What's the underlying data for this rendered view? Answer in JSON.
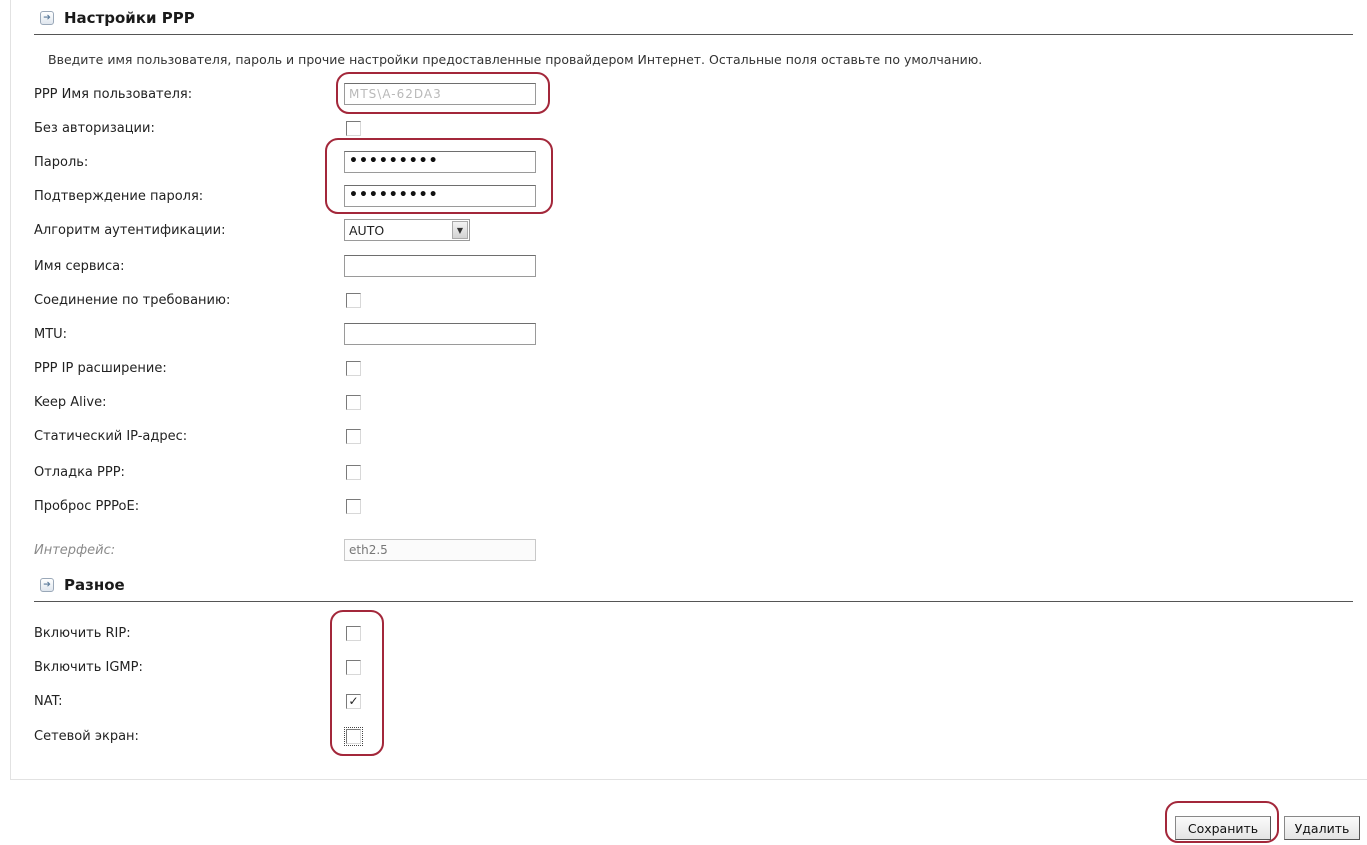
{
  "ppp_section": {
    "title": "Настройки PPP",
    "intro": "Введите имя пользователя, пароль и прочие настройки предоставленные провайдером Интернет. Остальные поля оставьте по умолчанию.",
    "username": {
      "label": "PPP Имя пользователя:",
      "value": "MTS\\A-62DA3"
    },
    "no_auth": {
      "label": "Без авторизации:",
      "checked": false
    },
    "password": {
      "label": "Пароль:",
      "value": "•••••••••"
    },
    "password_confirm": {
      "label": "Подтверждение пароля:",
      "value": "•••••••••"
    },
    "auth_algorithm": {
      "label": "Алгоритм аутентификации:",
      "value": "AUTO"
    },
    "service_name": {
      "label": "Имя сервиса:",
      "value": ""
    },
    "on_demand": {
      "label": "Соединение по требованию:",
      "checked": false
    },
    "mtu": {
      "label": "MTU:",
      "value": ""
    },
    "ppp_ip_ext": {
      "label": "PPP IP расширение:",
      "checked": false
    },
    "keep_alive": {
      "label": "Keep Alive:",
      "checked": false
    },
    "static_ip": {
      "label": "Статический IP-адрес:",
      "checked": false
    },
    "ppp_debug": {
      "label": "Отладка PPP:",
      "checked": false
    },
    "pppoe_passthrough": {
      "label": "Проброс PPPoE:",
      "checked": false
    },
    "interface": {
      "label": "Интерфейс:",
      "value": "eth2.5"
    }
  },
  "misc_section": {
    "title": "Разное",
    "rip": {
      "label": "Включить RIP:",
      "checked": false
    },
    "igmp": {
      "label": "Включить IGMP:",
      "checked": false
    },
    "nat": {
      "label": "NAT:",
      "checked": true
    },
    "firewall": {
      "label": "Сетевой экран:",
      "checked": false
    }
  },
  "buttons": {
    "save": "Сохранить",
    "delete": "Удалить"
  },
  "colors": {
    "highlight": "#a3273a",
    "rule": "#555555"
  },
  "icons": {
    "section": "arrow-in-box-icon",
    "select_arrow": "dropdown-arrow-icon",
    "check": "checkmark-icon"
  }
}
